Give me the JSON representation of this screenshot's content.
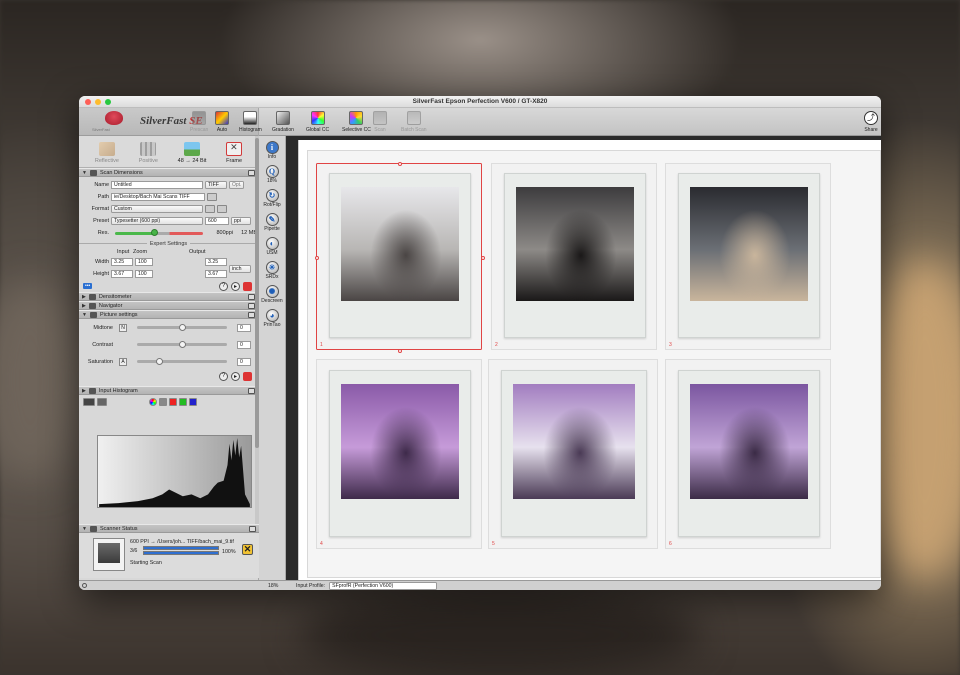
{
  "window": {
    "title": "SilverFast  Epson Perfection V600 / GT-X820"
  },
  "logo": {
    "name": "SilverFast",
    "edition": "SE",
    "sub": "SilverFast"
  },
  "modes": [
    {
      "label": "Reflective",
      "active": false
    },
    {
      "label": "Positive",
      "active": false
    },
    {
      "label": "48 → 24 Bit",
      "active": true
    },
    {
      "label": "Frame",
      "active": true
    }
  ],
  "toolbar": {
    "items": [
      {
        "label": "Prescan",
        "dim": true
      },
      {
        "label": "Auto",
        "dim": false
      },
      {
        "label": "Histogram",
        "dim": false
      },
      {
        "label": "Gradation",
        "dim": false
      },
      {
        "label": "Global CC",
        "dim": false
      },
      {
        "label": "Selective CC",
        "dim": false
      },
      {
        "label": "Scan",
        "dim": true
      },
      {
        "label": "Batch Scan",
        "dim": true
      }
    ],
    "share": "Share"
  },
  "tools": [
    {
      "label": "Info",
      "glyph": "i"
    },
    {
      "label": "18%",
      "glyph": "Q"
    },
    {
      "label": "Rot/Flip",
      "glyph": "↻"
    },
    {
      "label": "Pipette",
      "glyph": "✎"
    },
    {
      "label": "USM",
      "glyph": "◐"
    },
    {
      "label": "SRDx",
      "glyph": "✳"
    },
    {
      "label": "Descreen",
      "glyph": "✺"
    },
    {
      "label": "PrinTao",
      "glyph": "◕"
    }
  ],
  "scan_dimensions": {
    "header": "Scan Dimensions",
    "name_label": "Name",
    "name_value": "Untitled",
    "format_value": "TIFF",
    "opt_label": "Opt.",
    "path_label": "Path",
    "path_value": "ie/Desktop/Bach Mai Scans TIFF",
    "format_label": "Format",
    "format_select": "Custom",
    "preset_label": "Preset",
    "preset_value": "Typesetter (600 ppi)",
    "ppi_value": "600",
    "ppi_unit": "ppi",
    "res_label": "Res.",
    "res_value": "800ppi",
    "res_size": "12 MB",
    "res_level": 0.45,
    "expert": "Expert Settings",
    "input_label": "Input",
    "zoom_label": "Zoom",
    "output_label": "Output",
    "width_label": "Width",
    "width_input": "3.25",
    "width_zoom": "100",
    "width_output": "3.25",
    "height_label": "Height",
    "height_input": "3.67",
    "height_zoom": "100",
    "height_output": "3.67",
    "unit": "inch",
    "more": "•••"
  },
  "sections": {
    "densitometer": "Densitometer",
    "navigator": "Navigator",
    "picture": "Picture settings",
    "histogram": "Input Histogram",
    "scanner_status": "Scanner Status"
  },
  "picture_settings": [
    {
      "label": "Midtone",
      "badge": "N",
      "value": "0",
      "level": 0.5
    },
    {
      "label": "Contrast",
      "badge": "",
      "value": "0",
      "level": 0.5
    },
    {
      "label": "Saturation",
      "badge": "A",
      "value": "0",
      "level": 0.25
    }
  ],
  "scanner_status": {
    "line": "600 PPI → /Users/joh... TIFF/bach_mai_9.tif",
    "count": "3/6",
    "percent": "100%",
    "state": "Starting Scan",
    "progress": 1.0
  },
  "statusbar": {
    "zoom": "18%",
    "profile_label": "Input Profile:",
    "profile_value": "SFprofR (Perfection V600)"
  },
  "frames": [
    {
      "num": "1",
      "selected": true,
      "photo_colors": [
        "#e7e7ea",
        "#b8b6b4",
        "#4a4544"
      ]
    },
    {
      "num": "2",
      "selected": false,
      "photo_colors": [
        "#3d3c3e",
        "#8d8a87",
        "#1a1818"
      ]
    },
    {
      "num": "3",
      "selected": false,
      "photo_colors": [
        "#2a2b30",
        "#6b6f75",
        "#c9b59c"
      ]
    },
    {
      "num": "4",
      "selected": false,
      "photo_colors": [
        "#8a5aa8",
        "#c69bd9",
        "#3e2a4a"
      ]
    },
    {
      "num": "5",
      "selected": false,
      "photo_colors": [
        "#a27dc0",
        "#e7e1ee",
        "#4a3a55"
      ]
    },
    {
      "num": "6",
      "selected": false,
      "photo_colors": [
        "#7b56a0",
        "#c0a4d6",
        "#3b2b46"
      ]
    }
  ],
  "colors": {
    "accent_red": "#e04444",
    "progress_blue": "#2f6fd0"
  }
}
